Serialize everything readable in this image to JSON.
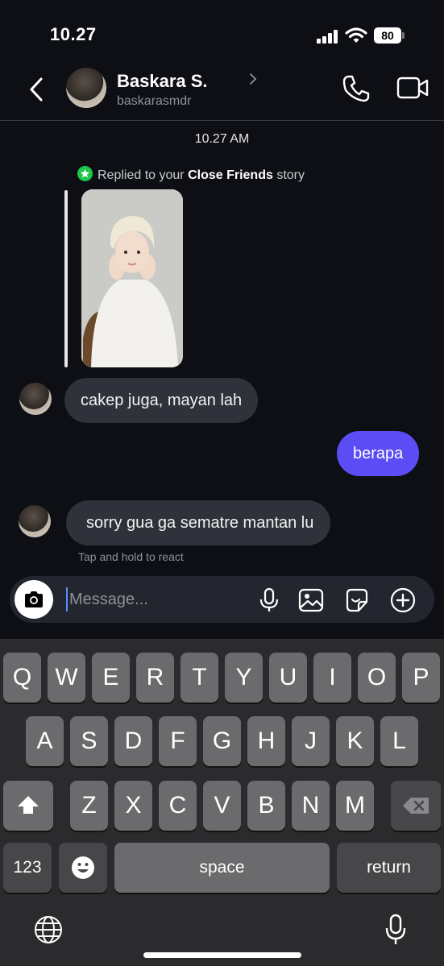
{
  "status_bar": {
    "time": "10.27",
    "battery": "80"
  },
  "header": {
    "name": "Baskara S.",
    "username": "baskarasmdr"
  },
  "chat": {
    "timestamp": "10.27 AM",
    "reply_note": {
      "prefix": "Replied to your ",
      "bold": "Close Friends",
      "suffix": " story"
    },
    "messages": [
      {
        "from": "them",
        "text": "cakep juga, mayan lah"
      },
      {
        "from": "me",
        "text": "berapa"
      },
      {
        "from": "them",
        "text": "sorry gua ga sematre mantan lu"
      }
    ],
    "react_hint": "Tap and hold to react"
  },
  "composer": {
    "placeholder": "Message..."
  },
  "keyboard": {
    "row1": [
      "Q",
      "W",
      "E",
      "R",
      "T",
      "Y",
      "U",
      "I",
      "O",
      "P"
    ],
    "row2": [
      "A",
      "S",
      "D",
      "F",
      "G",
      "H",
      "J",
      "K",
      "L"
    ],
    "row3": [
      "Z",
      "X",
      "C",
      "V",
      "B",
      "N",
      "M"
    ],
    "numbers": "123",
    "space": "space",
    "return": "return"
  },
  "colors": {
    "accent_bubble": "#5b4cf5",
    "close_friends_green": "#1fc64a",
    "background": "#0d0f14"
  }
}
